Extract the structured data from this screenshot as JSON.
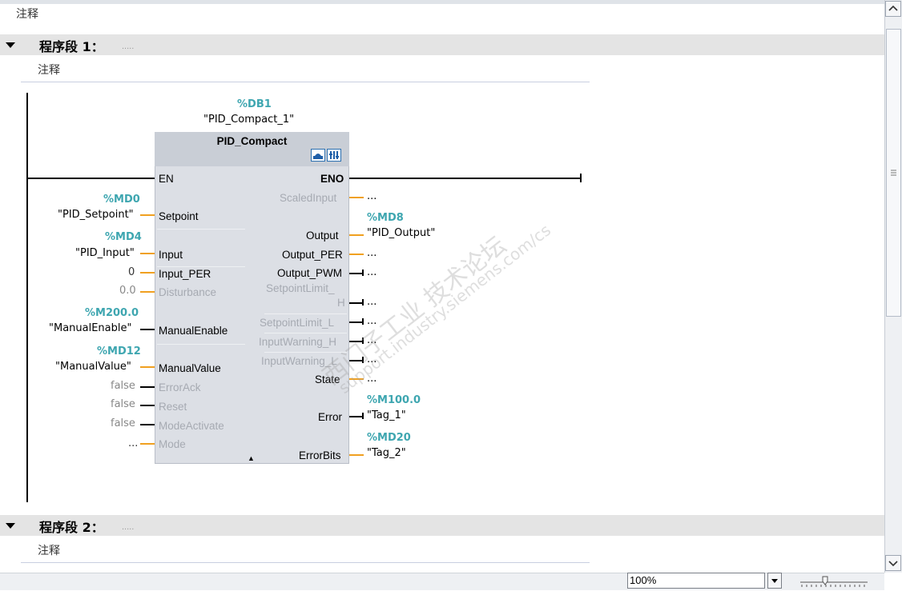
{
  "top_comment": "注释",
  "networks": [
    {
      "title": "程序段 1：",
      "dots": ".....",
      "comment": "注释"
    },
    {
      "title": "程序段 2：",
      "dots": ".....",
      "comment": "注释"
    }
  ],
  "fb": {
    "instance_address": "%DB1",
    "instance_name": "\"PID_Compact_1\"",
    "type": "PID_Compact",
    "expand_glyph": "▲"
  },
  "inputs": {
    "en": "EN",
    "setpoint": {
      "pin": "Setpoint",
      "addr": "%MD0",
      "tag": "\"PID_Setpoint\""
    },
    "input": {
      "pin": "Input",
      "addr": "%MD4",
      "tag": "\"PID_Input\""
    },
    "input_per": {
      "pin": "Input_PER",
      "value": "0"
    },
    "disturbance": {
      "pin": "Disturbance",
      "value": "0.0"
    },
    "manual_enable": {
      "pin": "ManualEnable",
      "addr": "%M200.0",
      "tag": "\"ManualEnable\""
    },
    "manual_value": {
      "pin": "ManualValue",
      "addr": "%MD12",
      "tag": "\"ManualValue\""
    },
    "error_ack": {
      "pin": "ErrorAck",
      "value": "false"
    },
    "reset": {
      "pin": "Reset",
      "value": "false"
    },
    "mode_activate": {
      "pin": "ModeActivate",
      "value": "false"
    },
    "mode": {
      "pin": "Mode",
      "value": "..."
    }
  },
  "outputs": {
    "eno": "ENO",
    "scaled_input": {
      "pin": "ScaledInput",
      "value": "..."
    },
    "output": {
      "pin": "Output",
      "addr": "%MD8",
      "tag": "\"PID_Output\""
    },
    "output_per": {
      "pin": "Output_PER",
      "value": "..."
    },
    "output_pwm": {
      "pin": "Output_PWM",
      "value": "..."
    },
    "setpoint_limit_h": {
      "pin_line1": "SetpointLimit_",
      "pin_line2": "H",
      "value": "..."
    },
    "setpoint_limit_l": {
      "pin": "SetpointLimit_L",
      "value": "..."
    },
    "input_warning_h": {
      "pin": "InputWarning_H",
      "value": "..."
    },
    "input_warning_l": {
      "pin": "InputWarning_L",
      "value": "..."
    },
    "state": {
      "pin": "State",
      "value": "..."
    },
    "error": {
      "pin": "Error",
      "addr": "%M100.0",
      "tag": "\"Tag_1\""
    },
    "error_bits": {
      "pin": "ErrorBits",
      "addr": "%MD20",
      "tag": "\"Tag_2\""
    }
  },
  "watermark": {
    "line1": "西门子工业  技术论坛",
    "line2": "support.industry.siemens.com/cs"
  },
  "zoom": {
    "value": "100%"
  },
  "colors": {
    "address": "#3ea6b0",
    "orange_wire": "#f0a020",
    "network_bar": "#e4e4e4",
    "fb_body": "#dcdfe5"
  }
}
